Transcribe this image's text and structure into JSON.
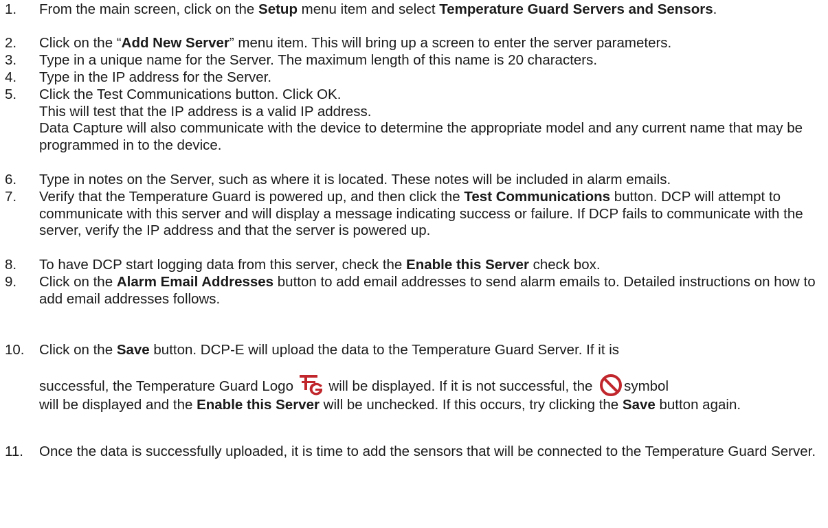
{
  "steps": [
    {
      "number": "1.",
      "t1": "From the main screen, click on the ",
      "b1": "Setup",
      "t2": " menu item and select ",
      "b2": "Temperature Guard Servers and Sensors",
      "t3": "."
    },
    {
      "number": "2.",
      "t1": "Click on the “",
      "b1": "Add New Server",
      "t2": "” menu item.  This will bring up a screen to enter the server parameters."
    },
    {
      "number": "3.",
      "text": "Type in a unique name for the Server.  The maximum length of this name is 20 characters."
    },
    {
      "number": "4.",
      "text": "Type in the IP address for the Server."
    },
    {
      "number": "5.",
      "line1": "Click the Test Communications button.  Click OK.",
      "line2": "This will test that the IP address is a valid IP address.",
      "line3": "Data Capture will also communicate with the device to determine the appropriate model and any current name that may be programmed in to the device."
    },
    {
      "number": "6.",
      "text": "Type in notes on the Server, such as where it is located.  These notes will be included in alarm emails."
    },
    {
      "number": "7.",
      "t1": "Verify that the Temperature Guard is powered up, and then click the ",
      "b1": "Test Communications",
      "t2": " button.  DCP will attempt to communicate with this server and will display a message indicating success or failure.  If DCP fails to communicate with the server, verify the IP address and that the server is powered up."
    },
    {
      "number": "8.",
      "t1": "To have DCP start logging data from this server, check the ",
      "b1": "Enable this Server",
      "t2": " check box."
    },
    {
      "number": "9.",
      "t1": "Click on the ",
      "b1": "Alarm Email Addresses",
      "t2": " button to add email addresses to send alarm emails to.  Detailed instructions on how to add email addresses follows."
    },
    {
      "number": "10.",
      "t1": "Click on the ",
      "b1": "Save",
      "t2": " button.  DCP-E will upload the data to the Temperature Guard Server.  If it is",
      "t3": "successful, the Temperature Guard Logo",
      "t4": " will be displayed.  If it is not successful, the",
      "t5": "symbol",
      "t6": "will be displayed and the ",
      "b2": "Enable this Server",
      "t7": " will be unchecked.  If this occurs, try clicking the ",
      "b3": "Save",
      "t8": " button again."
    },
    {
      "number": "11.",
      "text": "Once the data is successfully uploaded, it is time to add the sensors that will be connected to the Temperature Guard Server."
    }
  ],
  "icons": {
    "logo": "temperature-guard-logo-icon",
    "logo_color": "#c0262c",
    "no_symbol": "prohibited-icon",
    "no_symbol_color": "#c0262c"
  }
}
